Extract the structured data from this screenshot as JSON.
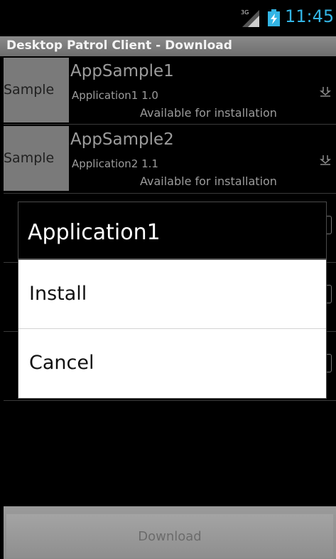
{
  "status_bar": {
    "network": "3G",
    "time": "11:45",
    "clock_color": "#33b5e5",
    "icons": [
      "signal-icon",
      "battery-icon"
    ]
  },
  "app_title": "Desktop Patrol Client - Download",
  "apps": [
    {
      "thumb": "Sample",
      "name": "AppSample1",
      "version": "Application1 1.0",
      "status": "Available for installation"
    },
    {
      "thumb": "Sample",
      "name": "AppSample2",
      "version": "Application2 1.1",
      "status": "Available for installation"
    }
  ],
  "dialog": {
    "title": "Application1",
    "options": [
      "Install",
      "Cancel"
    ]
  },
  "footer": {
    "download_label": "Download"
  }
}
